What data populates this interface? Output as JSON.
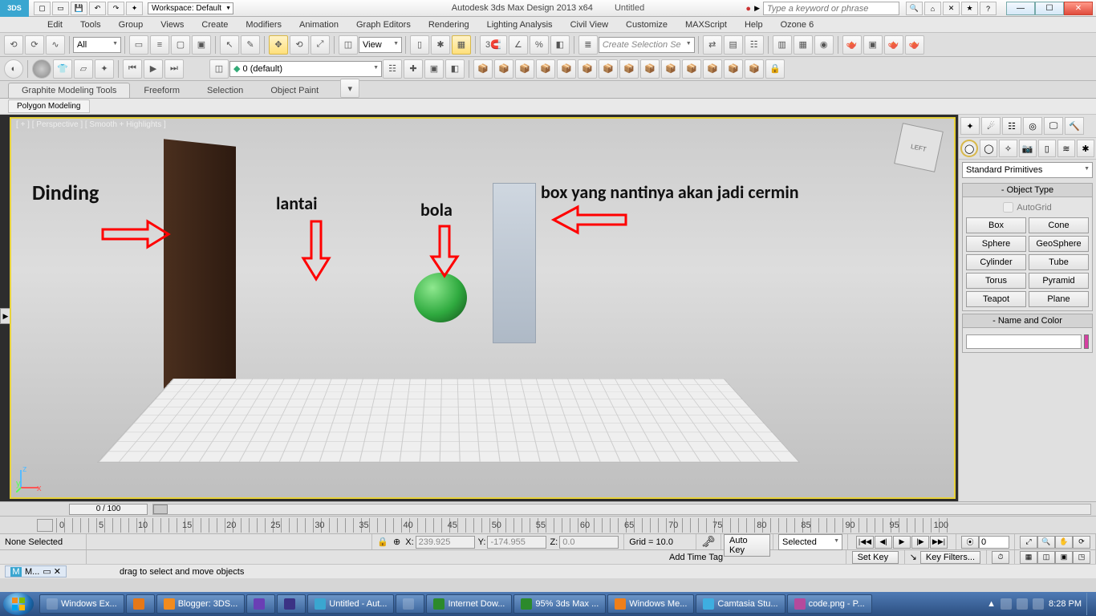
{
  "title": {
    "app": "Autodesk 3ds Max Design 2013 x64",
    "doc": "Untitled",
    "workspace": "Workspace: Default",
    "search_placeholder": "Type a keyword or phrase"
  },
  "menu": [
    "Edit",
    "Tools",
    "Group",
    "Views",
    "Create",
    "Modifiers",
    "Animation",
    "Graph Editors",
    "Rendering",
    "Lighting Analysis",
    "Civil View",
    "Customize",
    "MAXScript",
    "Help",
    "Ozone 6"
  ],
  "toolbar1": {
    "filter": "All",
    "view": "View",
    "selection_set_placeholder": "Create Selection Se",
    "three": "3"
  },
  "toolbar2": {
    "layer": "0 (default)"
  },
  "ribbon": {
    "tabs": [
      "Graphite Modeling Tools",
      "Freeform",
      "Selection",
      "Object Paint"
    ],
    "subtab": "Polygon Modeling"
  },
  "viewport": {
    "label": "[ + ] [ Perspective ] [ Smooth + Highlights ]",
    "cube_face": "LEFT"
  },
  "annotations": {
    "dinding": "Dinding",
    "lantai": "lantai",
    "bola": "bola",
    "box_mirror": "box yang nantinya akan jadi cermin"
  },
  "panel": {
    "category": "Standard Primitives",
    "object_type_title": "Object Type",
    "autogrid": "AutoGrid",
    "primitives": [
      [
        "Box",
        "Cone"
      ],
      [
        "Sphere",
        "GeoSphere"
      ],
      [
        "Cylinder",
        "Tube"
      ],
      [
        "Torus",
        "Pyramid"
      ],
      [
        "Teapot",
        "Plane"
      ]
    ],
    "name_color_title": "Name and Color"
  },
  "timeline": {
    "pos": "0 / 100",
    "ticks": [
      "0",
      "5",
      "10",
      "15",
      "20",
      "25",
      "30",
      "35",
      "40",
      "45",
      "50",
      "55",
      "60",
      "65",
      "70",
      "75",
      "80",
      "85",
      "90",
      "95",
      "100"
    ]
  },
  "status": {
    "none": "None Selected",
    "x_label": "X:",
    "x": "239.925",
    "y_label": "Y:",
    "y": "-174.955",
    "z_label": "Z:",
    "z": "0.0",
    "grid": "Grid = 10.0",
    "autokey": "Auto Key",
    "setkey": "Set Key",
    "mode": "Selected",
    "keyfilters": "Key Filters...",
    "frame": "0",
    "add_tag": "Add Time Tag"
  },
  "hint": {
    "prompt": "drag to select and move objects",
    "mini": "M..."
  },
  "taskbar": {
    "items": [
      "Windows Ex...",
      "",
      "Blogger: 3DS...",
      "",
      "",
      "Untitled - Aut...",
      "",
      "Internet Dow...",
      "95% 3ds Max ...",
      "Windows Me...",
      "Camtasia Stu...",
      "code.png - P..."
    ],
    "time": "8:28 PM"
  }
}
